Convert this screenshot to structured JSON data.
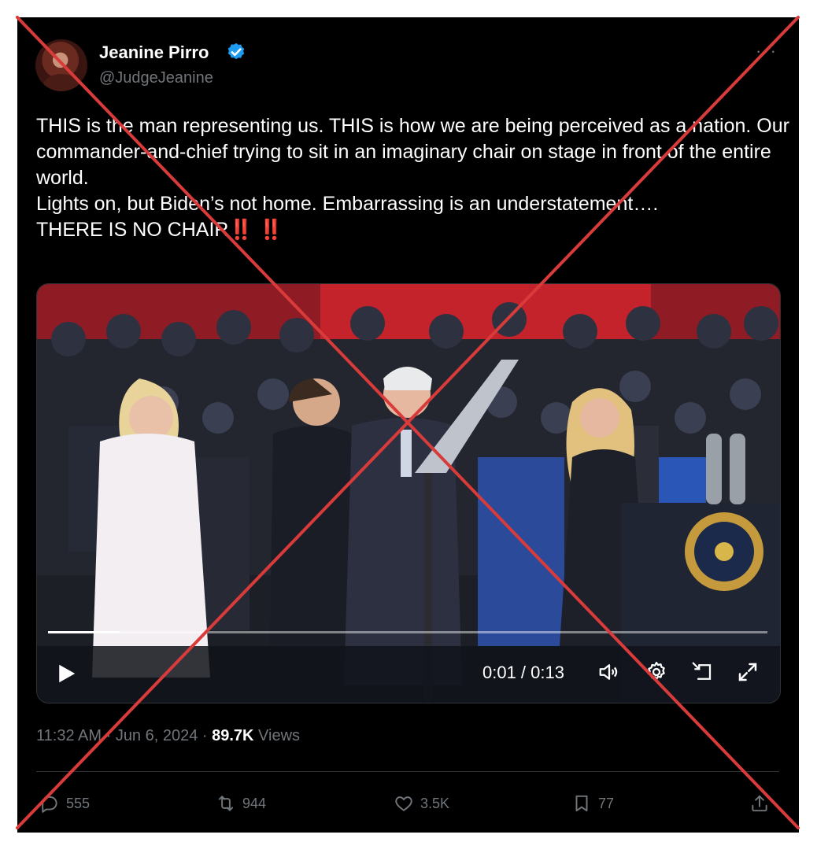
{
  "author": {
    "name": "Jeanine Pirro",
    "handle": "@JudgeJeanine",
    "verified_color": "#1d9bf0"
  },
  "more_label": "···",
  "tweet": {
    "lines": [
      "THIS is the man representing us. THIS is how we are being perceived as a nation. Our commander-and-chief trying to sit in an imaginary chair on stage in front of the entire world.",
      "Lights on, but Biden’s not home. Embarrassing is an understatement….",
      "THERE IS NO CHAIR"
    ],
    "emphasis": "‼️ ‼️"
  },
  "video": {
    "time": "0:01 / 0:13",
    "progress": 0.1,
    "controls": [
      "play-icon",
      "volume-icon",
      "settings-gear-icon",
      "picture-in-picture-icon",
      "fullscreen-icon"
    ]
  },
  "meta": {
    "time": "11:32 AM",
    "separator1": " · ",
    "date": "Jun 6, 2024",
    "separator2": " · ",
    "views_count": "89.7K",
    "views_label": " Views"
  },
  "actions": {
    "replies": "555",
    "reposts": "944",
    "likes": "3.5K",
    "bookmarks": "77"
  },
  "overlay": {
    "x_color": "#d93b3b"
  }
}
